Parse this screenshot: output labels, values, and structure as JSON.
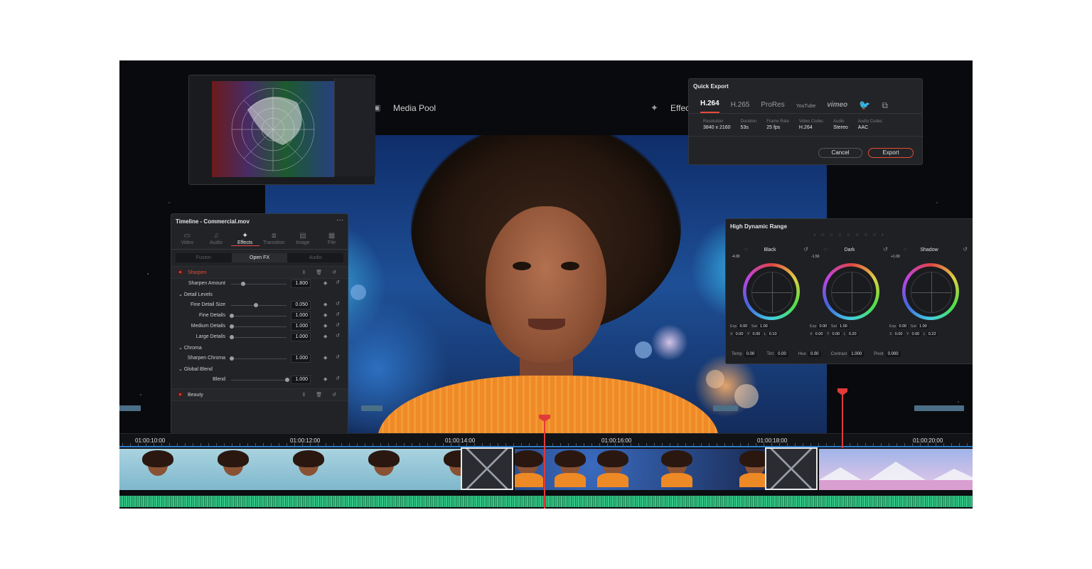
{
  "top_bar": {
    "media_pool": "Media Pool",
    "effects": "Effec"
  },
  "inspector": {
    "title": "Timeline - Commercial.mov",
    "tabs": [
      {
        "label": "Video",
        "icon": "video-icon"
      },
      {
        "label": "Audio",
        "icon": "audio-icon"
      },
      {
        "label": "Effects",
        "icon": "effects-wand-icon",
        "active": true
      },
      {
        "label": "Transition",
        "icon": "transition-icon"
      },
      {
        "label": "Image",
        "icon": "image-icon"
      },
      {
        "label": "File",
        "icon": "file-icon"
      }
    ],
    "subtabs": [
      "Fusion",
      "Open FX",
      "Audio"
    ],
    "active_subtab": "Open FX",
    "sharpen": {
      "label": "Sharpen",
      "amount_label": "Sharpen Amount",
      "amount": "1.800",
      "detail_levels": "Detail Levels",
      "fine_detail_size_label": "Fine Detail Size",
      "fine_detail_size": "0.050",
      "fine_details_label": "Fine Details",
      "fine_details": "1.000",
      "medium_details_label": "Medium Details",
      "medium_details": "1.000",
      "large_details_label": "Large Details",
      "large_details": "1.000",
      "chroma": "Chroma",
      "sharpen_chroma_label": "Sharpen Chroma",
      "sharpen_chroma": "1.000",
      "global_blend": "Global Blend",
      "blend_label": "Blend",
      "blend": "1.000"
    },
    "beauty_label": "Beauty"
  },
  "quick_export": {
    "title": "Quick Export",
    "formats": [
      "H.264",
      "H.265",
      "ProRes",
      "YouTube",
      "vimeo"
    ],
    "active_format": "H.264",
    "specs": [
      {
        "label": "Resolution",
        "value": "3840 x 2160"
      },
      {
        "label": "Duration",
        "value": "53s"
      },
      {
        "label": "Frame Rate",
        "value": "25 fps"
      },
      {
        "label": "Video Codec",
        "value": "H.264"
      },
      {
        "label": "Audio",
        "value": "Stereo"
      },
      {
        "label": "Audio Codec",
        "value": "AAC"
      }
    ],
    "cancel": "Cancel",
    "export": "Export"
  },
  "hdr": {
    "title": "High Dynamic Range",
    "wheels": [
      {
        "name": "Black",
        "value": "-4.00",
        "exp": "0.00",
        "sat": "1.00",
        "x": "0.00",
        "y": "0.00",
        "l": "0.10"
      },
      {
        "name": "Dark",
        "value": "-1.50",
        "exp": "0.00",
        "sat": "1.00",
        "x": "0.00",
        "y": "0.00",
        "l": "0.20"
      },
      {
        "name": "Shadow",
        "value": "+1.00",
        "exp": "0.00",
        "sat": "1.00",
        "x": "0.00",
        "y": "0.00",
        "l": "0.22"
      }
    ],
    "exp_label": "Exp",
    "sat_label": "Sat",
    "bottom": [
      {
        "label": "Temp",
        "value": "0.00"
      },
      {
        "label": "Tint",
        "value": "0.00"
      },
      {
        "label": "Hue",
        "value": "0.00"
      },
      {
        "label": "Contrast",
        "value": "1.000"
      },
      {
        "label": "Pivot",
        "value": "0.000"
      }
    ]
  },
  "timeline": {
    "timecodes": [
      "01:00:10:00",
      "01:00:12:00",
      "01:00:14:00",
      "01:00:16:00",
      "01:00:18:00",
      "01:00:20:00"
    ]
  },
  "colors": {
    "accent_red": "#e84a3a",
    "selected_blue": "#2b7fd0",
    "audio_green": "#2fb67a",
    "sweater_orange": "#ef8a26"
  }
}
